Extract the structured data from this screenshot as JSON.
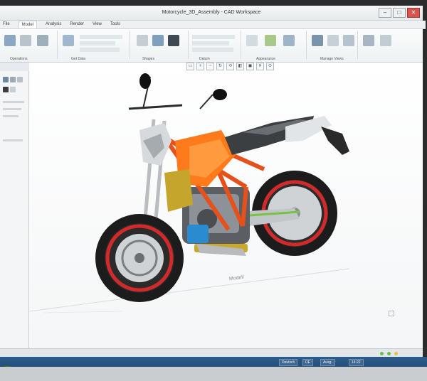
{
  "window": {
    "title": "Motorcycle_3D_Assembly - CAD Workspace",
    "controls": {
      "minimize": "–",
      "maximize": "□",
      "close": "✕"
    }
  },
  "ribbon": {
    "tabs": [
      "File",
      "Model",
      "Analysis",
      "Render",
      "View",
      "Tools"
    ],
    "active_tab": "Model",
    "groups": [
      "Operations",
      "Get Data",
      "Shapes",
      "Datum",
      "Appearance",
      "Manage Views"
    ]
  },
  "viewport": {
    "floor_label": "Modell",
    "model_name": "Motorcycle"
  },
  "view_toolbar": {
    "buttons": [
      "fit-icon",
      "zoom-in-icon",
      "zoom-out-icon",
      "repaint-icon",
      "orient-icon",
      "saved-views-icon",
      "display-style-icon",
      "datum-icon",
      "spin-icon"
    ]
  },
  "taskbar": {
    "items": [
      "Deutsch",
      "DE",
      "Ausg.",
      "14:22"
    ]
  },
  "colors": {
    "accent_orange": "#ff7a1a",
    "frame_orange": "#e6501b",
    "rim_red": "#c8282a",
    "taskbar": "#214a74"
  }
}
